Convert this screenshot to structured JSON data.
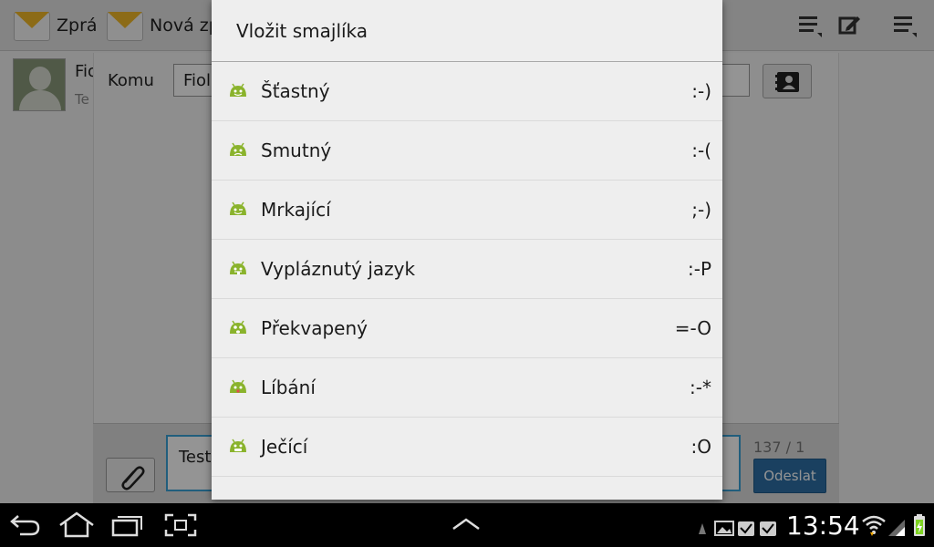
{
  "actionbar": {
    "tab1_label": "Zprá",
    "tab2_label": "Nová zp",
    "icons": [
      "menu-sort-icon",
      "compose-icon",
      "overflow-menu-icon"
    ]
  },
  "contact": {
    "name": "Fio",
    "sub": "Te"
  },
  "compose": {
    "to_label": "Komu",
    "to_value": "Fiol",
    "message_value": "Test",
    "counter": "137 / 1",
    "send_label": "Odeslat"
  },
  "dialog": {
    "title": "Vložit smajlíka",
    "items": [
      {
        "name": "Šťastný",
        "code": ":-)",
        "icon": "android-happy-icon"
      },
      {
        "name": "Smutný",
        "code": ":-(",
        "icon": "android-sad-icon"
      },
      {
        "name": "Mrkající",
        "code": ";-)",
        "icon": "android-wink-icon"
      },
      {
        "name": "Vypláznutý jazyk",
        "code": ":-P",
        "icon": "android-tongue-icon"
      },
      {
        "name": "Překvapený",
        "code": "=-O",
        "icon": "android-surprised-icon"
      },
      {
        "name": "Líbání",
        "code": ":-*",
        "icon": "android-kiss-icon"
      },
      {
        "name": "Ječící",
        "code": ":O",
        "icon": "android-yell-icon"
      }
    ],
    "accent": "#8ab32c"
  },
  "sysbar": {
    "time": "13:54"
  }
}
